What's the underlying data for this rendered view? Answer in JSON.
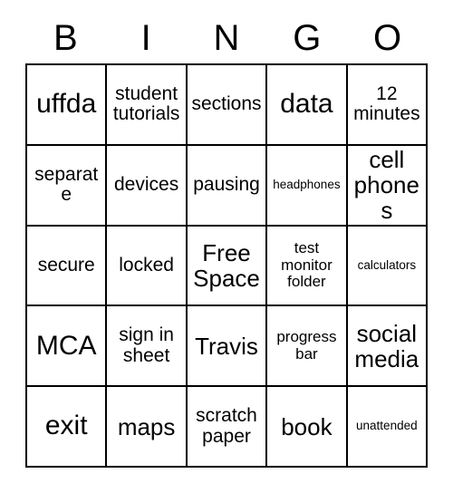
{
  "card": {
    "title": "BINGO",
    "headers": [
      "B",
      "I",
      "N",
      "G",
      "O"
    ],
    "free_space_label": "Free Space",
    "rows": [
      [
        {
          "text": "uffda",
          "size": "size-xl"
        },
        {
          "text": "student tutorials",
          "size": "size-md"
        },
        {
          "text": "sections",
          "size": "size-md"
        },
        {
          "text": "data",
          "size": "size-xl"
        },
        {
          "text": "12 minutes",
          "size": "size-md"
        }
      ],
      [
        {
          "text": "separate",
          "size": "size-md"
        },
        {
          "text": "devices",
          "size": "size-md"
        },
        {
          "text": "pausing",
          "size": "size-md"
        },
        {
          "text": "headphones",
          "size": "size-xs"
        },
        {
          "text": "cell phones",
          "size": "size-lg"
        }
      ],
      [
        {
          "text": "secure",
          "size": "size-md"
        },
        {
          "text": "locked",
          "size": "size-md"
        },
        {
          "text": "Free Space",
          "size": "size-lg"
        },
        {
          "text": "test monitor folder",
          "size": "size-sm"
        },
        {
          "text": "calculators",
          "size": "size-xs"
        }
      ],
      [
        {
          "text": "MCA",
          "size": "size-xl"
        },
        {
          "text": "sign in sheet",
          "size": "size-md"
        },
        {
          "text": "Travis",
          "size": "size-lg"
        },
        {
          "text": "progress bar",
          "size": "size-sm"
        },
        {
          "text": "social media",
          "size": "size-lg"
        }
      ],
      [
        {
          "text": "exit",
          "size": "size-xl"
        },
        {
          "text": "maps",
          "size": "size-lg"
        },
        {
          "text": "scratch paper",
          "size": "size-md"
        },
        {
          "text": "book",
          "size": "size-lg"
        },
        {
          "text": "unattended",
          "size": "size-xs"
        }
      ]
    ]
  },
  "colors": {
    "border": "#000000",
    "text": "#000000",
    "background": "#ffffff"
  }
}
